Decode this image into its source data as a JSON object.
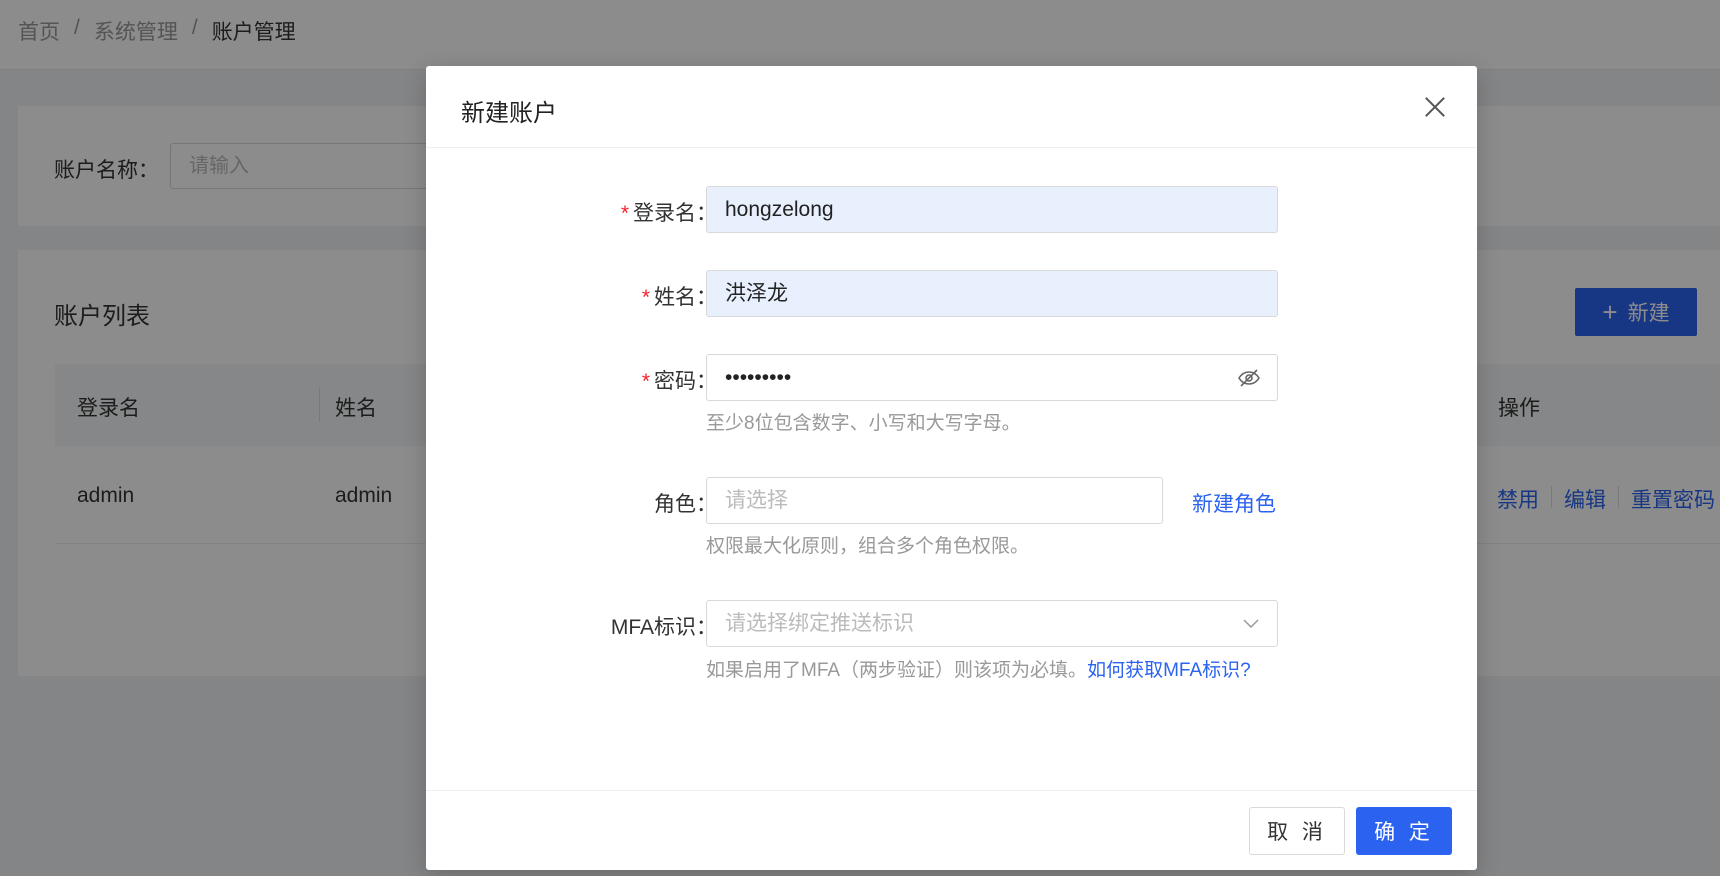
{
  "breadcrumb": {
    "items": [
      "首页",
      "系统管理",
      "账户管理"
    ],
    "separator": "/"
  },
  "filter": {
    "label": "账户名称：",
    "placeholder": "请输入"
  },
  "list": {
    "title": "账户列表",
    "new_button": "新建",
    "columns": [
      "登录名",
      "姓名",
      "操作"
    ],
    "rows": [
      {
        "login": "admin",
        "name": "admin",
        "actions": [
          "禁用",
          "编辑",
          "重置密码"
        ]
      }
    ]
  },
  "modal": {
    "title": "新建账户",
    "fields": {
      "login": {
        "required": "*",
        "label": "登录名：",
        "value": "hongzelong"
      },
      "name": {
        "required": "*",
        "label": "姓名：",
        "value": "洪泽龙"
      },
      "password": {
        "required": "*",
        "label": "密码：",
        "value": "•••••••••",
        "hint": "至少8位包含数字、小写和大写字母。"
      },
      "role": {
        "label": "角色：",
        "placeholder": "请选择",
        "link": "新建角色",
        "hint": "权限最大化原则，组合多个角色权限。"
      },
      "mfa": {
        "label": "MFA标识：",
        "placeholder": "请选择绑定推送标识",
        "hint": "如果启用了MFA（两步验证）则该项为必填。",
        "hint_link": "如何获取MFA标识?"
      }
    },
    "cancel_button": "取 消",
    "ok_button": "确 定"
  },
  "colors": {
    "primary": "#2b63f0",
    "required": "#f5222d",
    "autofill": "#e8f0fe"
  }
}
